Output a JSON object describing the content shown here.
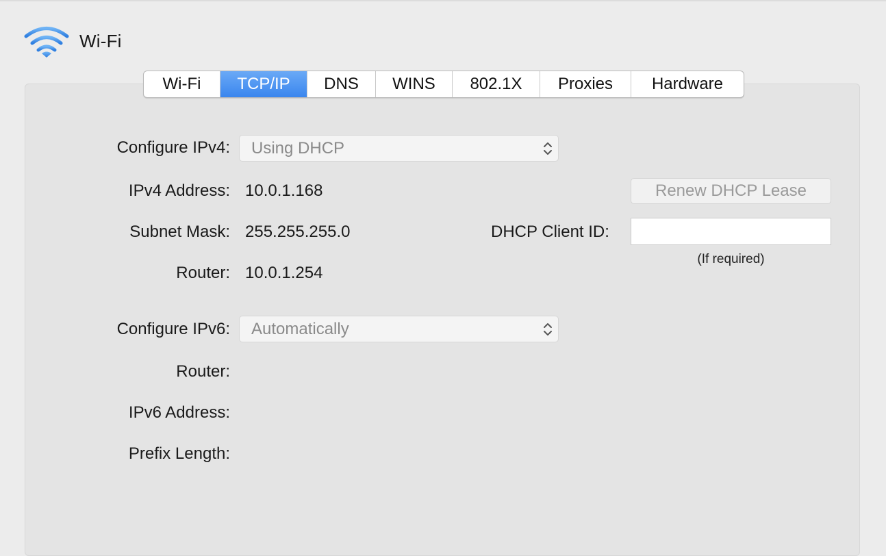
{
  "header": {
    "title": "Wi-Fi",
    "icon": "wifi-icon",
    "accent": "#4a90e2"
  },
  "tabs": [
    {
      "label": "Wi-Fi",
      "active": false
    },
    {
      "label": "TCP/IP",
      "active": true
    },
    {
      "label": "DNS",
      "active": false
    },
    {
      "label": "WINS",
      "active": false
    },
    {
      "label": "802.1X",
      "active": false
    },
    {
      "label": "Proxies",
      "active": false
    },
    {
      "label": "Hardware",
      "active": false
    }
  ],
  "ipv4": {
    "configure_label": "Configure IPv4:",
    "configure_value": "Using DHCP",
    "address_label": "IPv4 Address:",
    "address_value": "10.0.1.168",
    "subnet_label": "Subnet Mask:",
    "subnet_value": "255.255.255.0",
    "router_label": "Router:",
    "router_value": "10.0.1.254"
  },
  "dhcp": {
    "renew_label": "Renew DHCP Lease",
    "client_id_label": "DHCP Client ID:",
    "client_id_value": "",
    "hint": "(If required)"
  },
  "ipv6": {
    "configure_label": "Configure IPv6:",
    "configure_value": "Automatically",
    "router_label": "Router:",
    "address_label": "IPv6 Address:",
    "prefix_label": "Prefix Length:"
  },
  "colors": {
    "tab_active": "#3a86ee",
    "panel": "#e4e4e4",
    "window": "#ececec"
  }
}
